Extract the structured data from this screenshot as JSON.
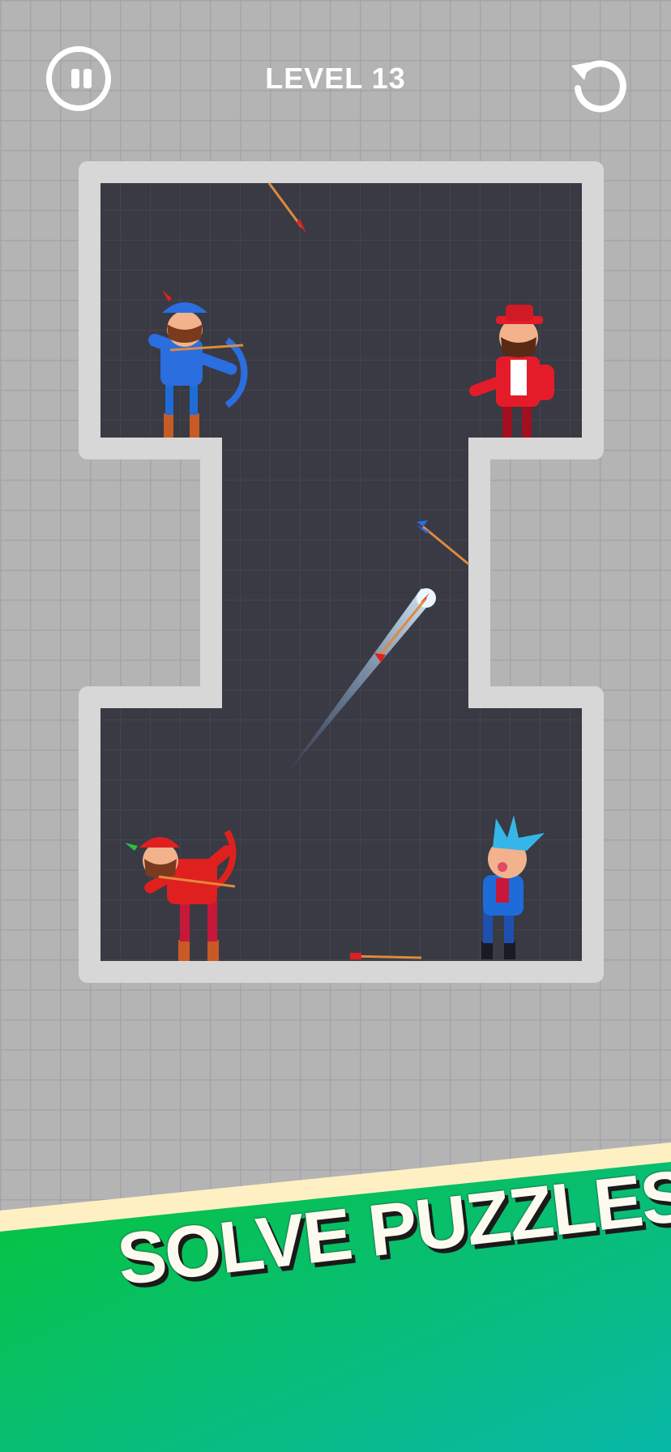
{
  "header": {
    "level_label": "LEVEL 13",
    "pause_icon": "pause-icon",
    "restart_icon": "restart-icon"
  },
  "banner": {
    "text": "SOLVE PUZZLES!",
    "colors": {
      "green_start": "#07c43a",
      "green_end": "#08b8a8",
      "cream": "#fff0c4"
    }
  },
  "colors": {
    "arena_floor": "#393a44",
    "arena_wall": "#d6d6d6",
    "player_archer": "#e0201e",
    "enemy_archer": "#2a6ee0",
    "enemy_red": "#e41c2a",
    "enemy_blue": "#1e6cd8"
  },
  "characters": [
    {
      "role": "enemy-archer",
      "color": "blue"
    },
    {
      "role": "enemy",
      "color": "red"
    },
    {
      "role": "player-archer",
      "color": "red"
    },
    {
      "role": "enemy",
      "color": "blue"
    }
  ]
}
